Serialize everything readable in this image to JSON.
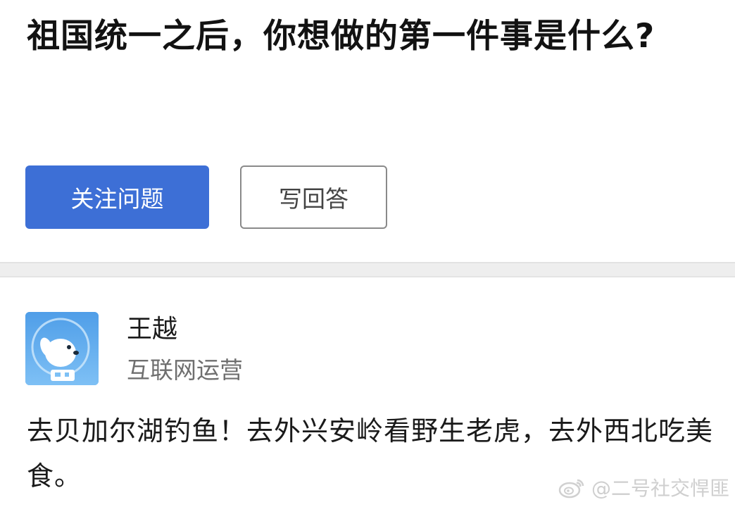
{
  "question": {
    "title": "祖国统一之后，你想做的第一件事是什么?"
  },
  "actions": {
    "follow_label": "关注问题",
    "answer_label": "写回答"
  },
  "author": {
    "name": "王越",
    "title": "互联网运营"
  },
  "answer": {
    "text": "去贝加尔湖钓鱼！去外兴安岭看野生老虎，去外西北吃美食。"
  },
  "watermark": {
    "text": "@二号社交悍匪"
  },
  "colors": {
    "primary": "#3d6fd6",
    "divider": "#eeeeee",
    "avatar_bg": "#5aa4e6"
  }
}
